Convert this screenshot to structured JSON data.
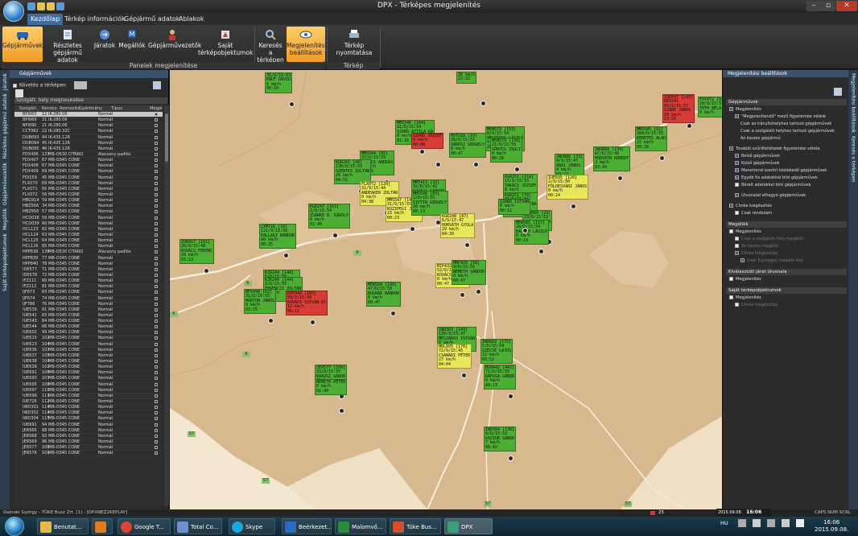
{
  "window": {
    "title": "DPX - Térképes megjelenítés"
  },
  "menu": {
    "tabs": [
      "Kezdőlap",
      "Térkép információk",
      "Gépjármű adatok",
      "Ablakok"
    ]
  },
  "ribbon": {
    "buttons": [
      "Gépjárművek",
      "Részletes gépjármű adatok",
      "Járatok",
      "Megállók",
      "Gépjárművezetők",
      "Saját térképobjektumok",
      "Keresés a térképen",
      "Megjelenítési beállítások",
      "Térkép nyomtatása"
    ],
    "groups": [
      "Panelek megjelenítése",
      "Térkép nyomtatása"
    ]
  },
  "left_strip": [
    "Járatok",
    "Részletes gépjármű adatok",
    "Gépjárművezetők",
    "Megállók",
    "Saját térképobjektumok"
  ],
  "left_panel": {
    "title": "Gépjárművek",
    "checkbox": "Követés a térképen",
    "filter": "Szolgált. hely megnevezése",
    "columns": [
      "Szolgált.",
      "Rendsz.",
      "Azonosító",
      "Gyártmány",
      "Típus",
      "Megjel."
    ],
    "rows": [
      [
        "BPI063",
        "12",
        "IK-280.06",
        "Normál"
      ],
      [
        "BPI069",
        "21",
        "IK-280.06",
        "Normál"
      ],
      [
        "BPI090",
        "21",
        "IK-280.06",
        "Normál"
      ],
      [
        "CCT062",
        "22",
        "IK-280.32C",
        "Normál"
      ],
      [
        "DUB093",
        "44",
        "IK-435.12R",
        "Normál"
      ],
      [
        "DUB094",
        "45",
        "IK-435.12R",
        "Normál"
      ],
      [
        "DUB095",
        "46",
        "IK-435.12R",
        "Normál"
      ],
      [
        "FDX406",
        "137",
        "MB-O530 CITARO",
        "Alacsony padlós"
      ],
      [
        "FDX407",
        "67",
        "MB-O345 CONE",
        "Normál"
      ],
      [
        "FDX408",
        "67",
        "MB-O345 CONE",
        "Normál"
      ],
      [
        "FDX409",
        "69",
        "MB-O345 CONE",
        "Normál"
      ],
      [
        "FDI159",
        "45",
        "MB-O345 CONE",
        "Normál"
      ],
      [
        "FLX070",
        "69",
        "MB-O345 CONE",
        "Normál"
      ],
      [
        "FLX071",
        "65",
        "MB-O345 CONE",
        "Normál"
      ],
      [
        "FLX072",
        "56",
        "MB-O345 CONE",
        "Normál"
      ],
      [
        "HBG914",
        "59",
        "MB-O345 CONE",
        "Normál"
      ],
      [
        "HBZ566",
        "34",
        "MB-O345 CONE",
        "Normál"
      ],
      [
        "HBZ958",
        "57",
        "MB-O345 CONE",
        "Normál"
      ],
      [
        "HCD038",
        "59",
        "MB-O345 CONE",
        "Normál"
      ],
      [
        "HCD039",
        "60",
        "MB-O345 CONE",
        "Normál"
      ],
      [
        "HCL123",
        "62",
        "MB-O345 CONE",
        "Normál"
      ],
      [
        "HCL124",
        "63",
        "MB-O345 CONE",
        "Normál"
      ],
      [
        "HCL125",
        "64",
        "MB-O345 CONE",
        "Normál"
      ],
      [
        "HCL126",
        "65",
        "MB-O345 CONE",
        "Normál"
      ],
      [
        "HPP838",
        "136",
        "MB-O530 CITARO",
        "Alacsony padlós"
      ],
      [
        "HPP839",
        "77",
        "MB-O345 CONE",
        "Normál"
      ],
      [
        "HPP840",
        "78",
        "MB-O345 CONE",
        "Normál"
      ],
      [
        "IDE577",
        "71",
        "MB-O345 CONE",
        "Normál"
      ],
      [
        "IDE578",
        "72",
        "MB-O345 CONE",
        "Normál"
      ],
      [
        "IFZ111",
        "80",
        "MB-O345 CONE",
        "Normál"
      ],
      [
        "IFZ112",
        "81",
        "MB-O345 CONE",
        "Normál"
      ],
      [
        "IJF673",
        "83",
        "MB-O345 CONE",
        "Normál"
      ],
      [
        "IJF674",
        "74",
        "MB-O345 CONE",
        "Normál"
      ],
      [
        "IJF786",
        "76",
        "MB-O345 CONE",
        "Normál"
      ],
      [
        "IUE539",
        "81",
        "MB-O345 CONE",
        "Normál"
      ],
      [
        "IUE541",
        "83",
        "MB-O345 CONE",
        "Normál"
      ],
      [
        "IUE543",
        "84",
        "MB-O345 CONE",
        "Normál"
      ],
      [
        "IUE544",
        "86",
        "MB-O345 CONE",
        "Normál"
      ],
      [
        "IUE602",
        "99",
        "MB-O345 CONE",
        "Normál"
      ],
      [
        "IUE615",
        "102",
        "MB-O345 CONE",
        "Normál"
      ],
      [
        "IUE623",
        "104",
        "MB-O345 CONE",
        "Normál"
      ],
      [
        "IUE636",
        "107",
        "MB-O345 CONE",
        "Normál"
      ],
      [
        "IUE637",
        "105",
        "MB-O345 CONE",
        "Normál"
      ],
      [
        "IUE638",
        "104",
        "MB-O345 CONE",
        "Normál"
      ],
      [
        "IUE639",
        "102",
        "MB-O345 CONE",
        "Normál"
      ],
      [
        "IUE691",
        "106",
        "MB-O345 CONE",
        "Normál"
      ],
      [
        "IUE693",
        "107",
        "MB-O345 CONE",
        "Normál"
      ],
      [
        "IUE695",
        "108",
        "MB-O345 CONE",
        "Normál"
      ],
      [
        "IUE697",
        "110",
        "MB-O345 CONE",
        "Normál"
      ],
      [
        "IUE699",
        "111",
        "MB-O345 CONE",
        "Normál"
      ],
      [
        "IUE726",
        "112",
        "MB-O345 CONE",
        "Normál"
      ],
      [
        "IWD301",
        "114",
        "MB-O345 CONE",
        "Normál"
      ],
      [
        "IWD302",
        "114",
        "MB-O345 CONE",
        "Normál"
      ],
      [
        "IWD304",
        "115",
        "MB-O345 CONE",
        "Normál"
      ],
      [
        "IUE691",
        "94",
        "MB-O345 CONE",
        "Normál"
      ],
      [
        "JER566",
        "88",
        "MB-O345 CONE",
        "Normál"
      ],
      [
        "JER568",
        "92",
        "MB-O345 CONE",
        "Normál"
      ],
      [
        "JER569",
        "96",
        "MB-O345 CONE",
        "Normál"
      ],
      [
        "JER577",
        "108",
        "MB-O345 CONE",
        "Normál"
      ],
      [
        "JER578",
        "109",
        "MB-O345 CONE",
        "Normál"
      ]
    ]
  },
  "map": {
    "road_numbers": [
      "6",
      "6",
      "6",
      "6",
      "57",
      "57",
      "57",
      "57",
      "57"
    ],
    "vehicles": [
      {
        "color": "green",
        "text": "36/9/15:03\nKNOT DÁVID\n0 km/h\n00:10"
      },
      {
        "color": "green",
        "text": "36 km/h\n22:32"
      },
      {
        "color": "red",
        "text": "IUE697 [143]\nDB1541\n60/9/15:57\nSZABÓ JÁNOS\n24 km/h\n13:26"
      },
      {
        "color": "green",
        "text": "FUY472 [5]\n20/9/15:5\nTÓTH BÉLA\n0 km/h"
      },
      {
        "color": "green",
        "text": "MMS546 [104]\n31/D/15:54\nSZABÓ ATTILA KÁ\n0 km/h\n01:16"
      },
      {
        "color": "red",
        "text": "SZABÓ JÓZSEF\n0 km/h\n00:49"
      },
      {
        "color": "green",
        "text": "MXT018 [10]\n26/D/15:55\nSÁRDSI GERGELY\n8 km/h\n00:47"
      },
      {
        "color": "green",
        "text": "MEW579 [153]\n8/9/15:54\nMÉSZÁROS LÁSZLÓ\n4 km/h\n28:28"
      },
      {
        "color": "green",
        "text": "MEW579 [150]\n21/9/15:55\nGÖNTES ZSOLT\n0 km/h\n00:28"
      },
      {
        "color": "green",
        "text": "MMS545 [92]\n389/D/15:55\nKERETES ALAD\n22 km/h\n00:38"
      },
      {
        "color": "green",
        "text": "JWU884 [134]\n47/D/15:48\nHORVÁTH RÓBERT\n3 km/h\n03:44"
      },
      {
        "color": "green",
        "text": "JWU886 [33]\n4/9/15:47\nABAI JÁNOS\n4 km/h\n03:22"
      },
      {
        "color": "yellow",
        "text": "IUE695 [126]\n2/9/15:50\nFÖLDESVÁRI JÁNOS\n0 km/h\n00:24"
      },
      {
        "color": "green",
        "text": "MMS544 [85]\n37/D/15:55\nTAKÁCS ANDRÁS\n0 km/h\n00:05"
      },
      {
        "color": "green",
        "text": "KGR241 [48]\n130/D/15:55\nSZENTES ZOLTÁN\n28 km/h\n04:51"
      },
      {
        "color": "green",
        "text": "MMT413 [32]\n32/D/15:42\nKOVÁCS SÁNDOR\n10 km/h\n00:38"
      },
      {
        "color": "yellow",
        "text": "FLX072 [120]\n31/9/15:44\nANDEAKER ZOLTÁN\n0 km/h\n04:38"
      },
      {
        "color": "yellow",
        "text": "MMS547 [145]\n31/9/15:55\nKOZIPEGI JÁNOS\n23 km/h\n00:23"
      },
      {
        "color": "green",
        "text": "MMS548 [83]\n2/D/15:55\nSIPTIN GERGELY\n20 km/h\n00:13"
      },
      {
        "color": "green",
        "text": "KGR251 [118]\n15/9/15:55\nTAKÁCS JÓZSEF\n8 km/h\n00:43"
      },
      {
        "color": "green",
        "text": "KGR251 [70]\n33/D/15:55\nFEKETE ZOLTÁN\n10 km/h\n00:15"
      },
      {
        "color": "green",
        "text": "JFB004 [29]\n29/D/15:53\nOLÁH ZOLTÁN\n0 km/h"
      },
      {
        "color": "green",
        "text": "KGR247 [161]\n2/D/15:54\nZSÁRKÓ B. KÁROLY\n0 km/h\n01:46"
      },
      {
        "color": "yellow",
        "text": "KGR248 [87]\n6/9/15:47\nHORVÁTH GYULA\n29 km/h\n04:39"
      },
      {
        "color": "green",
        "text": "MEW585 [117]\n28/D/15:54\nBALOGH LÁSZLÓ\n0 km/h\n00:19"
      },
      {
        "color": "green",
        "text": "SZABÓ ISTVÁN\n0 km/h\n00:12"
      },
      {
        "color": "green",
        "text": "LXM716 [18]\n121/9/15:50\nPALLAGI NÁNDOR\n40 km/h\n00:25"
      },
      {
        "color": "green",
        "text": "IUE657 [151]\n26/9/15:48\nKOVÁCS FERENC\n34 km/h\n01:13"
      },
      {
        "color": "green",
        "text": "KZR244 [148]\n5/D/15:50\nBENEDEK ATTILA\n0 km/h\n00:42"
      },
      {
        "color": "yellow",
        "text": "MIP432 [172]\n52/D/15:05\nKOVÁCS RÓBERT\n0 km/h\n00:47"
      },
      {
        "color": "green",
        "text": "KZR246 [144]\n3/D/15:55\nFERENCZI ZOLTÁN\n0 km/h\n00:01"
      },
      {
        "color": "green",
        "text": "MFX498 [62]\n31/D/15:55\nMÁRTON JÁNOS\n0 km/h\n03:25"
      },
      {
        "color": "green",
        "text": "MMP429 [58]\n9/D/15:55\nNÉMETH SÁNDOR\n0 km/h\n00:47"
      },
      {
        "color": "red",
        "text": "KPE344 [103]\n69/9/15:48\nKOVÁCS ISTVÁN Bt\n12 km/h\n00:11"
      },
      {
        "color": "green",
        "text": "MEW584 [198]\n47/D/15:50\nBOGNÁR NÁNDOR\n0 km/h\n00:47"
      },
      {
        "color": "green",
        "text": "IWD303 [149]\n130/9/15:47\nMÉSZÁROS ISTVÁN\n0 km/h\n00:51"
      },
      {
        "color": "yellow",
        "text": "MRL895 [170]\n72/9/15:45\nCSANÁDI PÉTER\n27 km/h\n04:04"
      },
      {
        "color": "green",
        "text": "IWD889 [175]\n5/D/15:54\nSZÉCSÉ LAJOS\n12 km/h\n00:52"
      },
      {
        "color": "green",
        "text": "MGB442 [442]\n71/D/15:55\nRÁPOSA GÁBOR\n0 km/h\n00:23"
      },
      {
        "color": "green",
        "text": "JER577 [109]\n33/D/15:55\nKRAUSZ GÁBOR\n61 km/h\n00:50"
      },
      {
        "color": "green",
        "text": "NÉMETH PÉTER\n0 km/h\n01:40"
      },
      {
        "color": "green",
        "text": "IWD304 [130]\n8/D/15:53\nKAZIUR GÁBOR\n7 km/h\n00:42"
      }
    ]
  },
  "right_panel": {
    "title": "Megjelenítési beállítások",
    "sections": [
      {
        "name": "Gépjárművek",
        "options": [
          {
            "t": "Megjelenítés",
            "on": true,
            "ind": 0
          },
          {
            "t": "\"Megjelenítendő\" mező figyelembe vétele",
            "on": true,
            "ind": 1
          },
          {
            "t": "Csak az irányítóhelyhez tartozó gépjárművek",
            "on": false,
            "ind": 2,
            "radio": true
          },
          {
            "t": "Csak a szolgálati helyhez tartozó gépjárművek",
            "on": false,
            "ind": 2,
            "radio": true
          },
          {
            "t": "Az összes gépjármű",
            "on": false,
            "ind": 2,
            "radio": true
          },
          {
            "t": "",
            "on": false,
            "ind": 0,
            "gap": true
          },
          {
            "t": "További szűrőfeltételek figyelembe vétele",
            "on": true,
            "ind": 0
          },
          {
            "t": "Belső gépjárművek",
            "on": true,
            "ind": 1
          },
          {
            "t": "Külső gépjárművek",
            "on": true,
            "ind": 1
          },
          {
            "t": "Menetrend szerint közlekedő gépjárművek",
            "on": true,
            "ind": 1
          },
          {
            "t": "Egyéb fix adatokkal bíró gépjárművek",
            "on": true,
            "ind": 1
          },
          {
            "t": "Bérelt adatokkal bíró gépjárművek",
            "on": false,
            "ind": 1
          },
          {
            "t": "",
            "on": false,
            "ind": 0,
            "gap": true
          },
          {
            "t": "Útvonalat elhagyó gépjárművek",
            "on": true,
            "ind": 1
          },
          {
            "t": "",
            "on": false,
            "ind": 0,
            "gap": true
          },
          {
            "t": "Címke kiegészítés",
            "on": true,
            "ind": 0
          },
          {
            "t": "Csak rendszám",
            "on": false,
            "ind": 1
          }
        ]
      },
      {
        "name": "Megállók",
        "options": [
          {
            "t": "Megjelenítés",
            "on": false,
            "ind": 0
          },
          {
            "t": "Csak a szolgálati hely megállói",
            "on": false,
            "ind": 1,
            "dis": true
          },
          {
            "t": "Az összes megálló",
            "on": false,
            "ind": 1,
            "dis": true
          },
          {
            "t": "Címke kiegészítés",
            "on": true,
            "ind": 1,
            "dis": true
          },
          {
            "t": "Csak Egységes megálló kód",
            "on": true,
            "ind": 2,
            "dis": true
          }
        ]
      },
      {
        "name": "Kiválasztott járat útvonala",
        "options": [
          {
            "t": "Megjelenítés",
            "on": false,
            "ind": 0
          }
        ]
      },
      {
        "name": "Saját térképobjektumok",
        "options": [
          {
            "t": "Megjelenítés",
            "on": false,
            "ind": 0
          },
          {
            "t": "Címke kiegészítés",
            "on": false,
            "ind": 1,
            "dis": true
          }
        ]
      }
    ]
  },
  "right_strip": [
    "Megjelenítési beállítások",
    "Keresés a térképen"
  ],
  "status": {
    "user": "Dalnoki György - TÜKE Busz Zrt. [1] - [DPXNEZ2KEPLAY]",
    "alert_count": "25",
    "date": "2015.09.08.",
    "time": "16:06",
    "indicators": "CAPS  NUM  SCRL  INS"
  },
  "taskbar": {
    "buttons": [
      "Benutat...",
      "",
      "Google T...",
      "Total Co...",
      "Skype",
      "Beérkezet...",
      "Malomvő...",
      "Tüke Bus...",
      "DPX"
    ],
    "lang": "HU",
    "time": "16:06",
    "date": "2015.09.08."
  }
}
